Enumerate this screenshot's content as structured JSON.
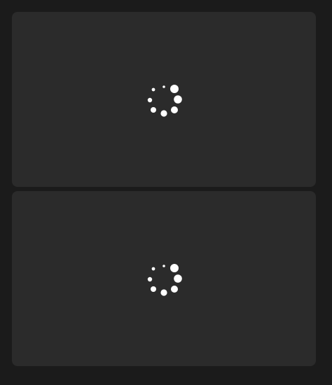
{
  "panels": [
    {
      "icon": "loading-spinner-icon",
      "color": "#ffffff"
    },
    {
      "icon": "loading-spinner-icon",
      "color": "#ffffff"
    }
  ],
  "colors": {
    "background": "#1b1b1b",
    "panel": "#2b2b2b",
    "spinner": "#ffffff"
  }
}
